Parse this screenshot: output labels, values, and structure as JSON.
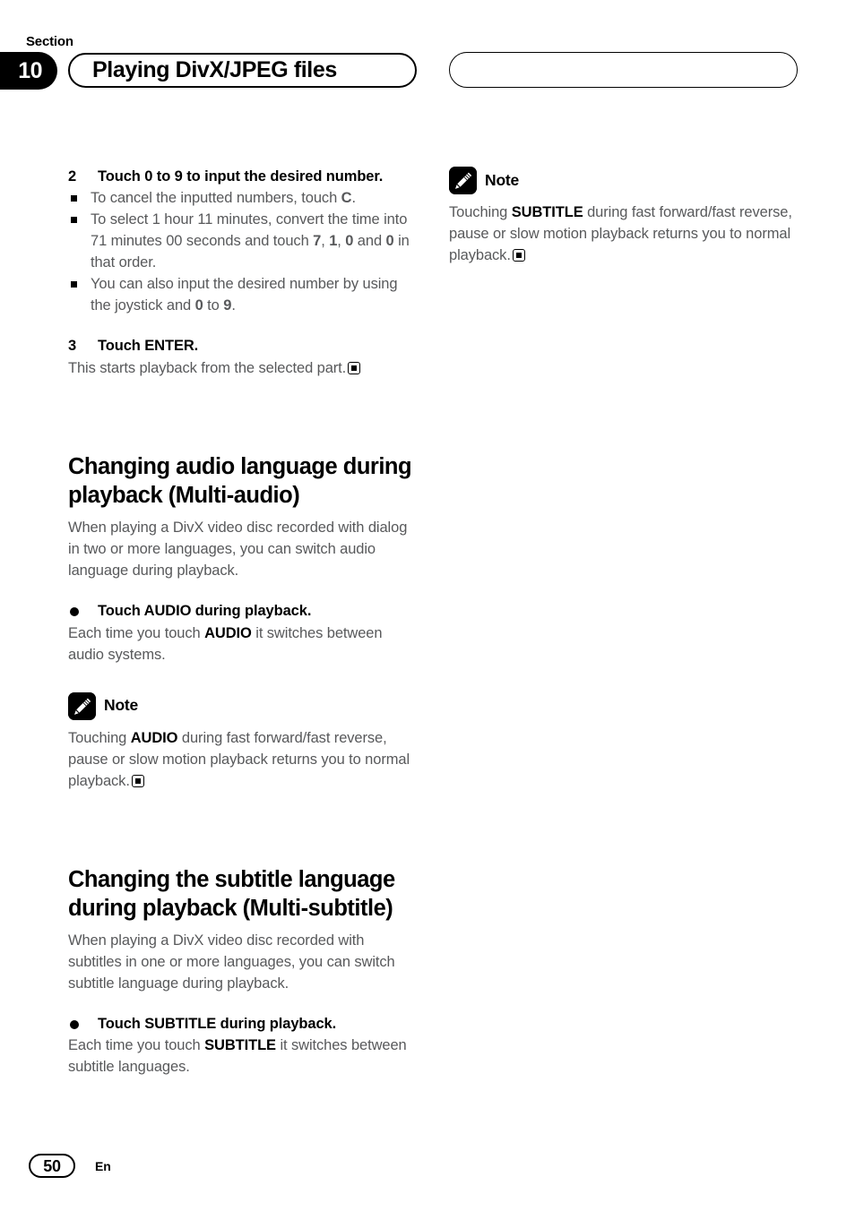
{
  "header": {
    "section_label": "Section",
    "section_number": "10",
    "title": "Playing DivX/JPEG files",
    "right_pill_text": ""
  },
  "left_column": {
    "step2": {
      "number": "2",
      "text": "Touch 0 to 9 to input the desired number."
    },
    "step2_bullets": [
      {
        "parts": [
          {
            "t": "To cancel the inputted numbers, touch ",
            "b": false
          },
          {
            "t": "C",
            "b": true
          },
          {
            "t": ".",
            "b": false
          }
        ]
      },
      {
        "parts": [
          {
            "t": "To select 1 hour 11 minutes, convert the time into 71 minutes 00 seconds and touch ",
            "b": false
          },
          {
            "t": "7",
            "b": true
          },
          {
            "t": ", ",
            "b": false
          },
          {
            "t": "1",
            "b": true
          },
          {
            "t": ", ",
            "b": false
          },
          {
            "t": "0",
            "b": true
          },
          {
            "t": " and ",
            "b": false
          },
          {
            "t": "0",
            "b": true
          },
          {
            "t": " in that order.",
            "b": false
          }
        ]
      },
      {
        "parts": [
          {
            "t": "You can also input the desired number by using the joystick and ",
            "b": false
          },
          {
            "t": "0",
            "b": true
          },
          {
            "t": " to ",
            "b": false
          },
          {
            "t": "9",
            "b": true
          },
          {
            "t": ".",
            "b": false
          }
        ]
      }
    ],
    "step3": {
      "number": "3",
      "text": "Touch ENTER."
    },
    "step3_body": {
      "parts": [
        {
          "t": "This starts playback from the selected part.",
          "b": false
        }
      ],
      "endmark": true
    },
    "heading_audio": "Changing audio language during playback (Multi-audio)",
    "intro_audio": {
      "parts": [
        {
          "t": "When playing a DivX video disc recorded with dialog in two or more languages, you can switch audio language during playback.",
          "b": false
        }
      ]
    },
    "dot_audio": "Touch AUDIO during playback.",
    "dot_audio_body": {
      "parts": [
        {
          "t": "Each time you touch ",
          "b": false
        },
        {
          "t": "AUDIO",
          "b": true
        },
        {
          "t": " it switches between audio systems.",
          "b": false
        }
      ]
    },
    "note_audio": {
      "label": "Note",
      "icon": "pencil-note-icon",
      "body": {
        "parts": [
          {
            "t": "Touching ",
            "b": false
          },
          {
            "t": "AUDIO",
            "b": true
          },
          {
            "t": " during fast forward/fast reverse, pause or slow motion playback returns you to normal playback.",
            "b": false
          }
        ],
        "endmark": true
      }
    },
    "heading_subtitle": "Changing the subtitle language during playback (Multi-subtitle)",
    "intro_subtitle": {
      "parts": [
        {
          "t": "When playing a DivX video disc recorded with subtitles in one or more languages, you can switch subtitle language during playback.",
          "b": false
        }
      ]
    },
    "dot_subtitle": "Touch SUBTITLE during playback.",
    "dot_subtitle_body": {
      "parts": [
        {
          "t": "Each time you touch ",
          "b": false
        },
        {
          "t": "SUBTITLE",
          "b": true
        },
        {
          "t": " it switches between subtitle languages.",
          "b": false
        }
      ]
    }
  },
  "right_column": {
    "note_subtitle": {
      "label": "Note",
      "icon": "pencil-note-icon",
      "body": {
        "parts": [
          {
            "t": "Touching ",
            "b": false
          },
          {
            "t": "SUBTITLE",
            "b": true
          },
          {
            "t": " during fast forward/fast reverse, pause or slow motion playback returns you to normal playback.",
            "b": false
          }
        ],
        "endmark": true
      }
    }
  },
  "footer": {
    "page_number": "50",
    "language_code": "En"
  },
  "colors": {
    "body_text": "#58595b",
    "emphasis_text": "#000000",
    "accent": "#000000",
    "background": "#ffffff"
  }
}
